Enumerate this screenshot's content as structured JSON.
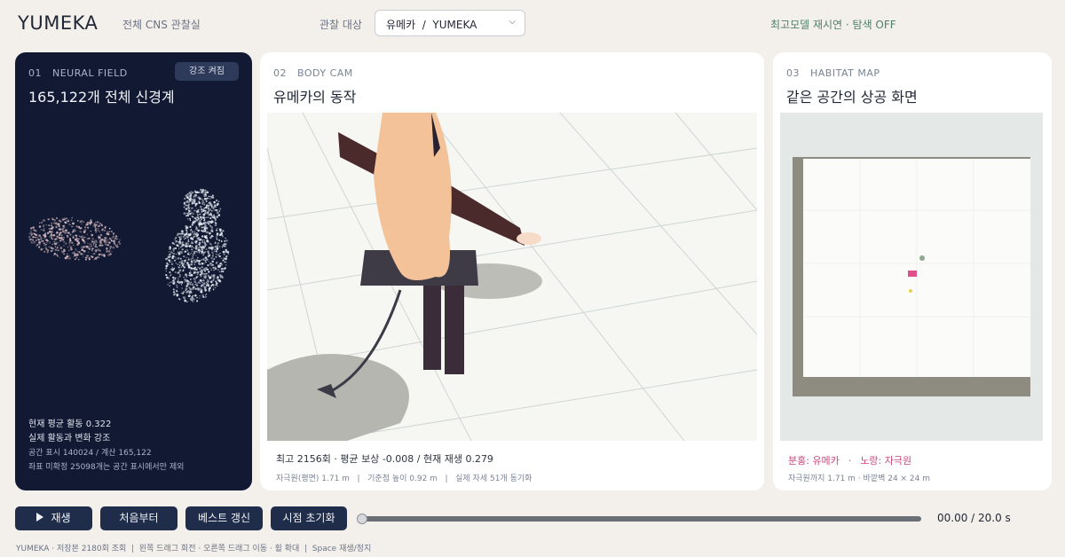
{
  "header": {
    "brand": "YUMEKA",
    "subtitle": "전체 CNS 관찰실",
    "target_label": "관찰 대상",
    "target_value": "유메카  /  YUMEKA",
    "status": "최고모델 재시연 · 탐색 OFF"
  },
  "panels": {
    "neural": {
      "kicker": "01   NEURAL FIELD",
      "title": "165,122개 전체 신경계",
      "emphasis_button": "강조 켜짐",
      "stat_activity": "현재 평균 활동 0.322",
      "stat_highlight": "실제 활동과 변화 강조",
      "stat_display": "공간 표시 140024 / 계산 165,122",
      "stat_excluded": "좌표 미확정 25098개는 공간 표시에서만 제외"
    },
    "bodycam": {
      "kicker": "02   BODY CAM",
      "title": "유메카의 동작",
      "stats": "최고 2156회 · 평균 보상 -0.008 / 현재 재생 0.279",
      "sub": "자극원(평면) 1.71 m   |   기준점 높이 0.92 m   |   실제 자세 51개 동기화"
    },
    "habitat": {
      "kicker": "03   HABITAT MAP",
      "title": "같은 공간의 상공 화면",
      "legend_pink": "분홍: 유메카",
      "legend_sep": "·",
      "legend_yellow": "노랑: 자극원",
      "sub": "자극원까지 1.71 m · 바깥벽 24 × 24 m"
    }
  },
  "controls": {
    "play": "재생",
    "restart": "처음부터",
    "best_update": "베스트 갱신",
    "reset_view": "시점 초기화",
    "progress": 0.0,
    "time_readout": "00.00 / 20.0 s"
  },
  "footer": "YUMEKA · 저장본 2180회 조회  |  왼쪽 드래그 회전 · 오른쪽 드래그 이동 · 휠 확대  |  Space 재생/정지",
  "colors": {
    "neural_bg": "#111a32",
    "button_bg": "#1f2d4a",
    "status_green": "#4f7f68",
    "legend_pink": "#c8497b",
    "agent_pink": "#e0508a",
    "stimulus_yellow": "#e6d24a"
  },
  "icons": {
    "play": "play-icon",
    "dropdown": "chevron-down-icon"
  }
}
